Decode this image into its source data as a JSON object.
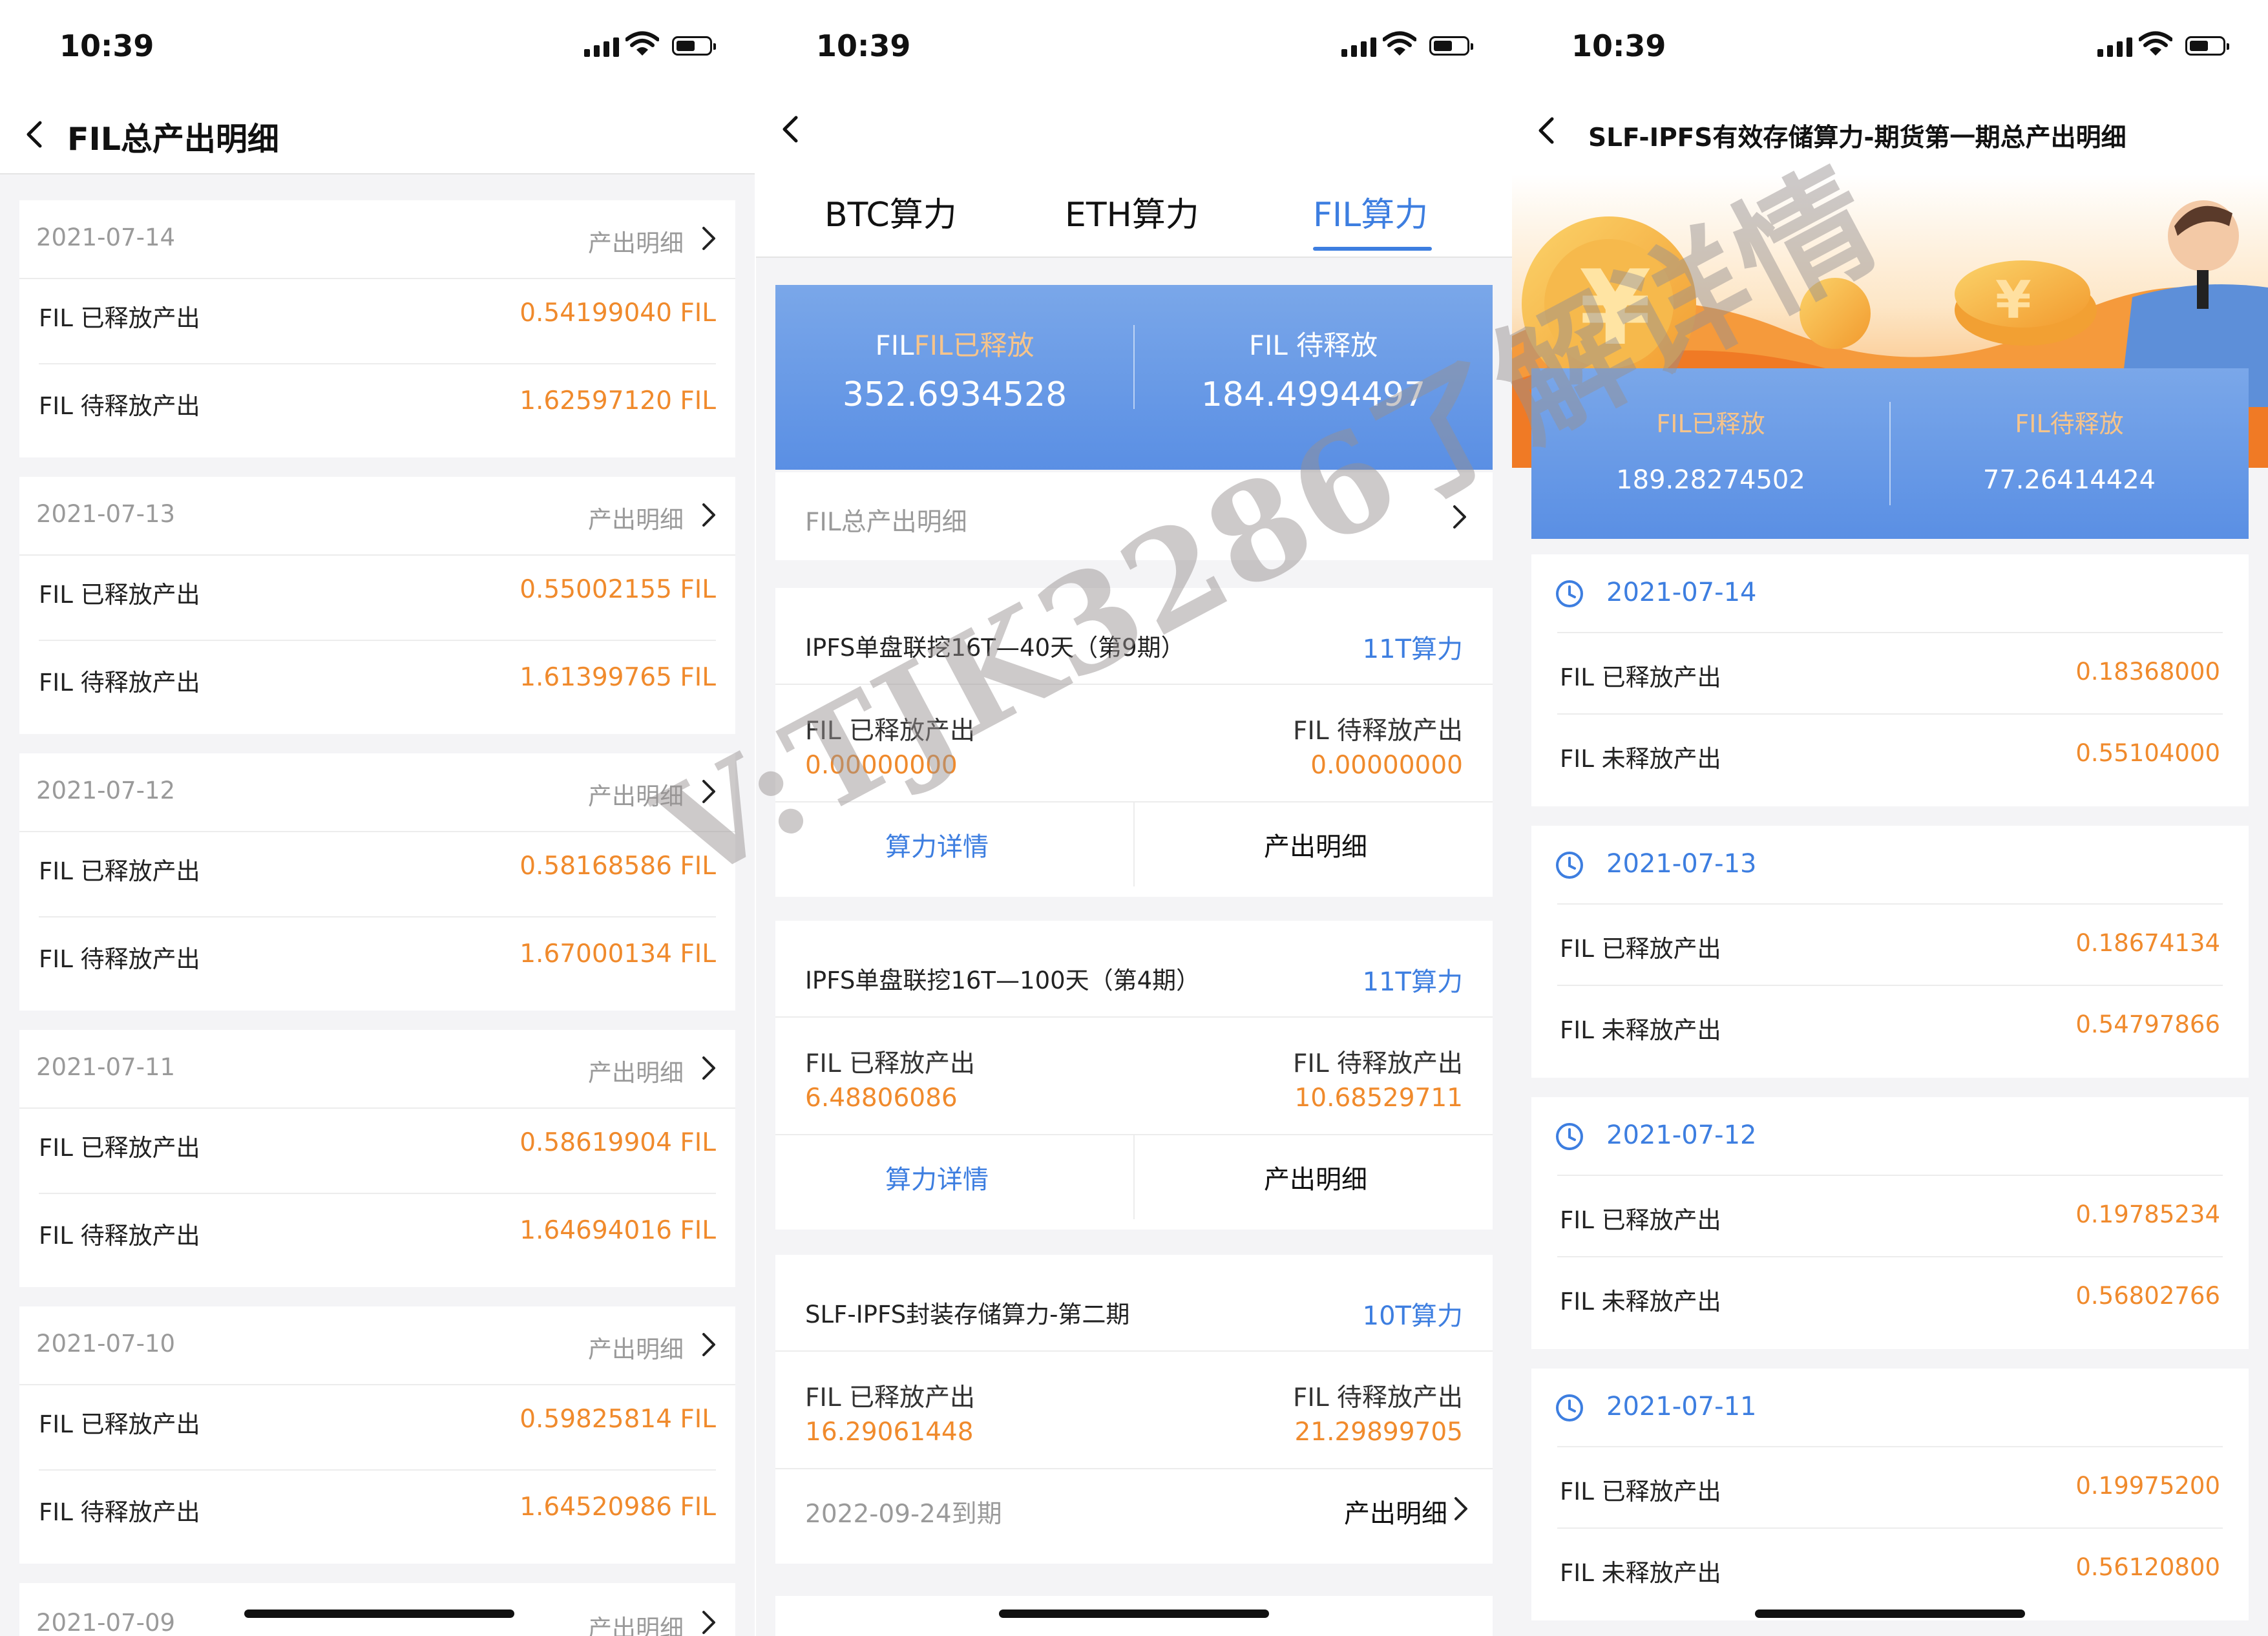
{
  "status": {
    "time": "10:39"
  },
  "p1": {
    "title": "FIL总产出明细",
    "link_label": "产出明细",
    "rows": [
      {
        "date": "2021-07-14",
        "released_label": "FIL 已释放产出",
        "released": "0.54199040 FIL",
        "pending_label": "FIL 待释放产出",
        "pending": "1.62597120 FIL"
      },
      {
        "date": "2021-07-13",
        "released_label": "FIL 已释放产出",
        "released": "0.55002155 FIL",
        "pending_label": "FIL 待释放产出",
        "pending": "1.61399765 FIL"
      },
      {
        "date": "2021-07-12",
        "released_label": "FIL 已释放产出",
        "released": "0.58168586 FIL",
        "pending_label": "FIL 待释放产出",
        "pending": "1.67000134 FIL"
      },
      {
        "date": "2021-07-11",
        "released_label": "FIL 已释放产出",
        "released": "0.58619904 FIL",
        "pending_label": "FIL 待释放产出",
        "pending": "1.64694016 FIL"
      },
      {
        "date": "2021-07-10",
        "released_label": "FIL 已释放产出",
        "released": "0.59825814 FIL",
        "pending_label": "FIL 待释放产出",
        "pending": "1.64520986 FIL"
      }
    ],
    "partial_date": "2021-07-09"
  },
  "p2": {
    "tabs": [
      "BTC算力",
      "ETH算力",
      "FIL算力"
    ],
    "banner": {
      "released_label": "FIL已释放",
      "released": "352.6934528",
      "pending_label": "FIL 待释放",
      "pending": "184.4994497"
    },
    "total_link": "FIL总产出明细",
    "products": [
      {
        "name": "IPFS单盘联挖16T—40天（第9期）",
        "power": "11T算力",
        "released_label": "FIL 已释放产出",
        "released": "0.00000000",
        "pending_label": "FIL 待释放产出",
        "pending": "0.00000000",
        "btn_left": "算力详情",
        "btn_right": "产出明细"
      },
      {
        "name": "IPFS单盘联挖16T—100天（第4期）",
        "power": "11T算力",
        "released_label": "FIL 已释放产出",
        "released": "6.48806086",
        "pending_label": "FIL 待释放产出",
        "pending": "10.68529711",
        "btn_left": "算力详情",
        "btn_right": "产出明细"
      },
      {
        "name": "SLF-IPFS封装存储算力-第二期",
        "power": "10T算力",
        "released_label": "FIL 已释放产出",
        "released": "16.29061448",
        "pending_label": "FIL 待释放产出",
        "pending": "21.29899705",
        "expiry": "2022-09-24到期",
        "btn_right": "产出明细"
      }
    ]
  },
  "p3": {
    "title": "SLF-IPFS有效存储算力-期货第一期总产出明细",
    "banner": {
      "released_label": "FIL已释放",
      "released": "189.28274502",
      "pending_label": "FIL待释放",
      "pending": "77.26414424"
    },
    "rows": [
      {
        "date": "2021-07-14",
        "released_label": "FIL 已释放产出",
        "released": "0.18368000",
        "pending_label": "FIL 未释放产出",
        "pending": "0.55104000"
      },
      {
        "date": "2021-07-13",
        "released_label": "FIL 已释放产出",
        "released": "0.18674134",
        "pending_label": "FIL 未释放产出",
        "pending": "0.54797866"
      },
      {
        "date": "2021-07-12",
        "released_label": "FIL 已释放产出",
        "released": "0.19785234",
        "pending_label": "FIL 未释放产出",
        "pending": "0.56802766"
      },
      {
        "date": "2021-07-11",
        "released_label": "FIL 已释放产出",
        "released": "0.19975200",
        "pending_label": "FIL 未释放产出",
        "pending": "0.56120800"
      }
    ]
  },
  "watermark": "V:TJK3286了解详情",
  "colors": {
    "accent": "#3d7ee0",
    "value": "#f08a2c",
    "banner": "#6a9ae6"
  }
}
